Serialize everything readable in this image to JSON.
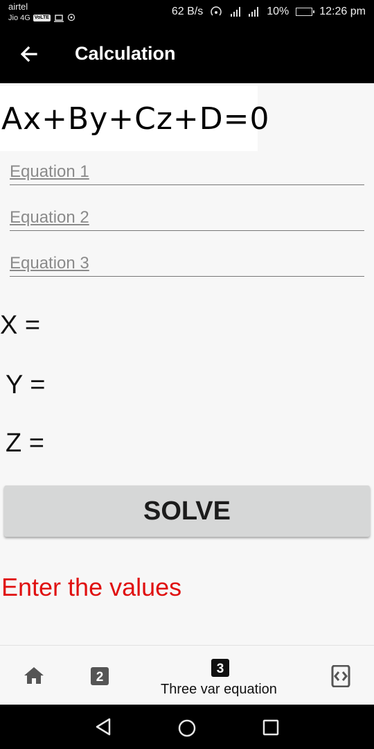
{
  "status_bar": {
    "carrier_1": "airtel",
    "carrier_2": "Jio 4G",
    "volte": "VoLTE",
    "speed": "62 B/s",
    "network_type": "4G",
    "battery": "10%",
    "time": "12:26 pm"
  },
  "app_bar": {
    "title": "Calculation",
    "back_icon": "arrow-left-icon"
  },
  "formula": "Ax+By+Cz+D=0",
  "inputs": [
    {
      "placeholder": "Equation 1",
      "value": ""
    },
    {
      "placeholder": "Equation 2",
      "value": ""
    },
    {
      "placeholder": "Equation 3",
      "value": ""
    }
  ],
  "results": {
    "x_label": "X =",
    "y_label": "Y =",
    "z_label": "Z ="
  },
  "solve_button": "SOLVE",
  "message": "Enter the values",
  "message_color": "#e01010",
  "bottom_nav": {
    "items": [
      {
        "icon": "home-icon",
        "label": ""
      },
      {
        "icon": "two-box-icon",
        "label": "",
        "glyph": "2"
      },
      {
        "icon": "three-box-icon",
        "label": "Three var equation",
        "glyph": "3",
        "selected": true
      },
      {
        "icon": "code-box-icon",
        "label": ""
      }
    ]
  },
  "system_nav": {
    "back": "triangle-back-icon",
    "home": "circle-home-icon",
    "recents": "square-recents-icon"
  }
}
